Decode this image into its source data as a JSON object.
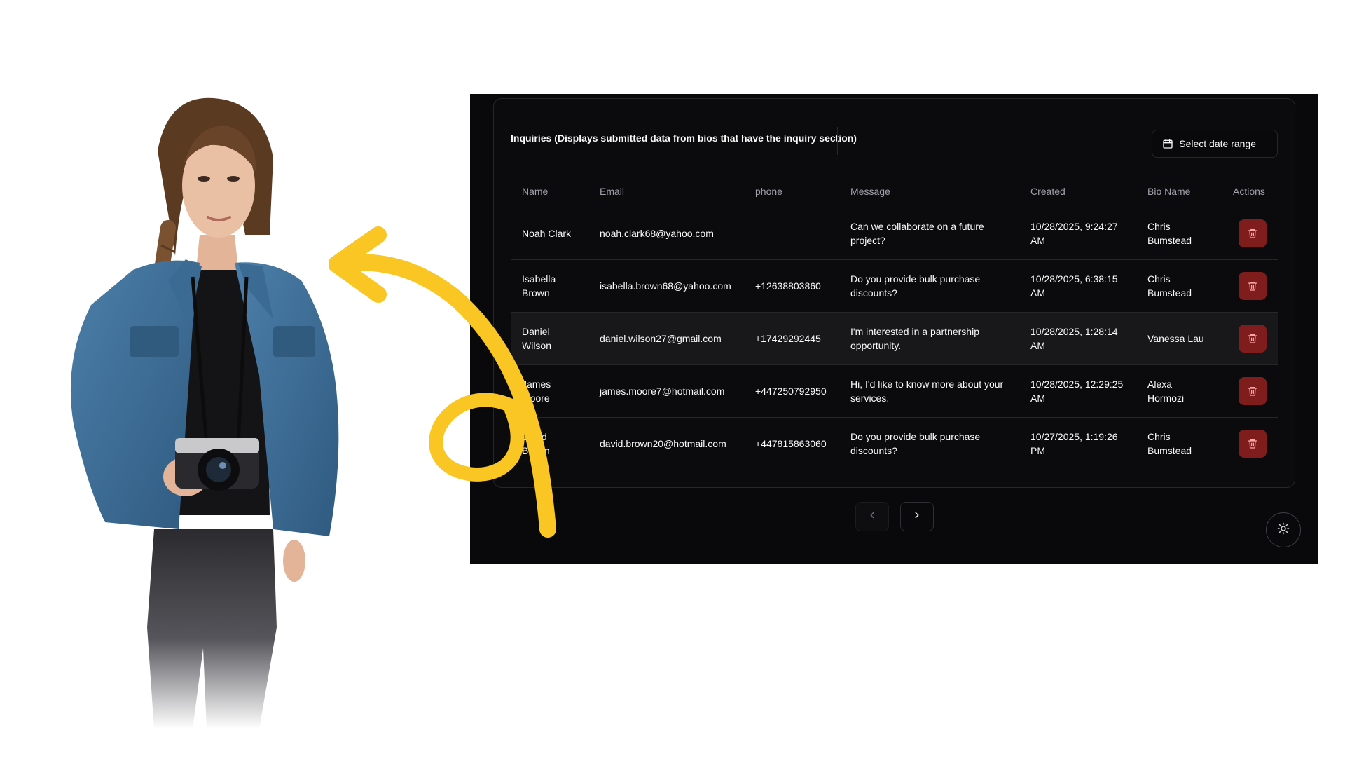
{
  "inquiries": {
    "title": "Inquiries (Displays submitted data from bios that have the inquiry section)",
    "date_range_label": "Select date range",
    "columns": [
      "Name",
      "Email",
      "phone",
      "Message",
      "Created",
      "Bio Name",
      "Actions"
    ],
    "rows": [
      {
        "name": "Noah Clark",
        "email": "noah.clark68@yahoo.com",
        "phone": "",
        "message": "Can we collaborate on a future project?",
        "created": "10/28/2025, 9:24:27 AM",
        "bio_name": "Chris Bumstead"
      },
      {
        "name": "Isabella Brown",
        "email": "isabella.brown68@yahoo.com",
        "phone": "+12638803860",
        "message": "Do you provide bulk purchase discounts?",
        "created": "10/28/2025, 6:38:15 AM",
        "bio_name": "Chris Bumstead"
      },
      {
        "name": "Daniel Wilson",
        "email": "daniel.wilson27@gmail.com",
        "phone": "+17429292445",
        "message": "I'm interested in a partnership opportunity.",
        "created": "10/28/2025, 1:28:14 AM",
        "bio_name": "Vanessa Lau"
      },
      {
        "name": "James Moore",
        "email": "james.moore7@hotmail.com",
        "phone": "+447250792950",
        "message": "Hi, I'd like to know more about your services.",
        "created": "10/28/2025, 12:29:25 AM",
        "bio_name": "Alexa Hormozi"
      },
      {
        "name": "David Brown",
        "email": "david.brown20@hotmail.com",
        "phone": "+447815863060",
        "message": "Do you provide bulk purchase discounts?",
        "created": "10/27/2025, 1:19:26 PM",
        "bio_name": "Chris Bumstead"
      }
    ],
    "highlighted_row": 2
  },
  "icons": {
    "date_button": "calendar-icon",
    "row_action": "trash-icon",
    "pager_prev": "chevron-left-icon",
    "pager_next": "chevron-right-icon",
    "theme_toggle": "sun-icon",
    "decoration": "curly-arrow-icon"
  },
  "colors": {
    "app_background": "#09090b",
    "card_border": "#27272a",
    "muted_text": "#a1a1aa",
    "delete_button": "#7f1d1d",
    "arrow": "#f9c623",
    "denim": "#3a6b94"
  }
}
